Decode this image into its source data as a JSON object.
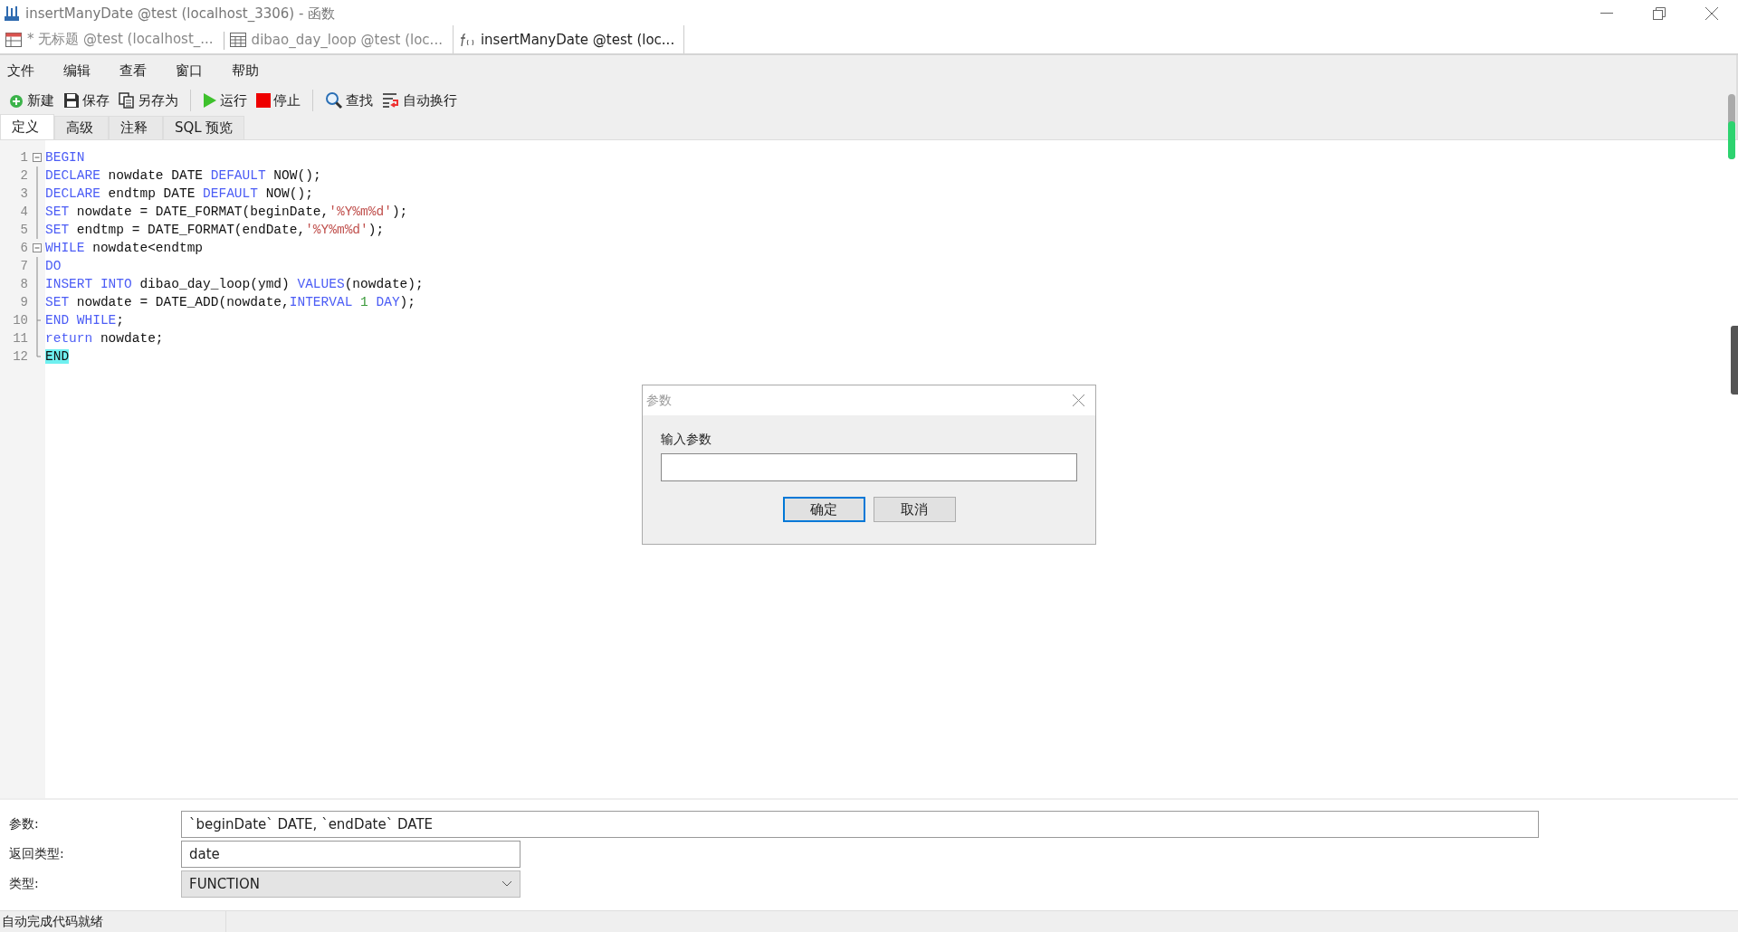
{
  "window": {
    "title": "insertManyDate @test (localhost_3306) - 函数"
  },
  "doc_tabs": [
    {
      "label": "* 无标题 @test (localhost_...",
      "selected": false
    },
    {
      "label": "dibao_day_loop @test (loc...",
      "selected": false
    },
    {
      "label": "insertManyDate @test (loc...",
      "selected": true
    }
  ],
  "menu": [
    "文件",
    "编辑",
    "查看",
    "窗口",
    "帮助"
  ],
  "toolbar": [
    "新建",
    "保存",
    "另存为",
    "运行",
    "停止",
    "查找",
    "自动换行"
  ],
  "sub_tabs": [
    {
      "label": "定义",
      "selected": true
    },
    {
      "label": "高级",
      "selected": false
    },
    {
      "label": "注释",
      "selected": false
    },
    {
      "label": "SQL 预览",
      "selected": false
    }
  ],
  "code_lines": [
    {
      "number": "1",
      "fold_start": true,
      "fold_end": false,
      "tokens": [
        {
          "kind": "kw",
          "text": "BEGIN"
        }
      ]
    },
    {
      "number": "2",
      "fold_start": false,
      "fold_end": false,
      "tokens": [
        {
          "kind": "kw",
          "text": "DECLARE"
        },
        {
          "kind": "plain",
          "text": " nowdate DATE "
        },
        {
          "kind": "kw",
          "text": "DEFAULT"
        },
        {
          "kind": "plain",
          "text": " NOW();"
        }
      ]
    },
    {
      "number": "3",
      "fold_start": false,
      "fold_end": false,
      "tokens": [
        {
          "kind": "kw",
          "text": "DECLARE"
        },
        {
          "kind": "plain",
          "text": " endtmp DATE "
        },
        {
          "kind": "kw",
          "text": "DEFAULT"
        },
        {
          "kind": "plain",
          "text": " NOW();"
        }
      ]
    },
    {
      "number": "4",
      "fold_start": false,
      "fold_end": false,
      "tokens": [
        {
          "kind": "kw",
          "text": "SET"
        },
        {
          "kind": "plain",
          "text": " nowdate = DATE_FORMAT(beginDate,"
        },
        {
          "kind": "str",
          "text": "'%Y%m%d'"
        },
        {
          "kind": "plain",
          "text": ");"
        }
      ]
    },
    {
      "number": "5",
      "fold_start": false,
      "fold_end": false,
      "tokens": [
        {
          "kind": "kw",
          "text": "SET"
        },
        {
          "kind": "plain",
          "text": " endtmp = DATE_FORMAT(endDate,"
        },
        {
          "kind": "str",
          "text": "'%Y%m%d'"
        },
        {
          "kind": "plain",
          "text": ");"
        }
      ]
    },
    {
      "number": "6",
      "fold_start": true,
      "fold_end": false,
      "tokens": [
        {
          "kind": "kw",
          "text": "WHILE"
        },
        {
          "kind": "plain",
          "text": " nowdate<endtmp"
        }
      ]
    },
    {
      "number": "7",
      "fold_start": false,
      "fold_end": false,
      "tokens": [
        {
          "kind": "kw",
          "text": "DO"
        }
      ]
    },
    {
      "number": "8",
      "fold_start": false,
      "fold_end": false,
      "tokens": [
        {
          "kind": "kw",
          "text": "INSERT INTO"
        },
        {
          "kind": "plain",
          "text": " dibao_day_loop(ymd) "
        },
        {
          "kind": "kw",
          "text": "VALUES"
        },
        {
          "kind": "plain",
          "text": "(nowdate);"
        }
      ]
    },
    {
      "number": "9",
      "fold_start": false,
      "fold_end": false,
      "tokens": [
        {
          "kind": "kw",
          "text": "SET"
        },
        {
          "kind": "plain",
          "text": " nowdate = DATE_ADD(nowdate,"
        },
        {
          "kind": "kw",
          "text": "INTERVAL"
        },
        {
          "kind": "num",
          "text": " 1"
        },
        {
          "kind": "kw",
          "text": " DAY"
        },
        {
          "kind": "plain",
          "text": ");"
        }
      ]
    },
    {
      "number": "10",
      "fold_start": false,
      "fold_end": true,
      "tokens": [
        {
          "kind": "kw",
          "text": "END WHILE"
        },
        {
          "kind": "plain",
          "text": ";"
        }
      ]
    },
    {
      "number": "11",
      "fold_start": false,
      "fold_end": false,
      "tokens": [
        {
          "kind": "kw",
          "text": "return"
        },
        {
          "kind": "plain",
          "text": " nowdate;"
        }
      ]
    },
    {
      "number": "12",
      "fold_start": false,
      "fold_end": true,
      "tokens": [
        {
          "kind": "match",
          "text": "END"
        }
      ]
    }
  ],
  "dialog": {
    "title": "参数",
    "label": "输入参数",
    "buttons": [
      {
        "label": "确定",
        "default": true
      },
      {
        "label": "取消",
        "default": false
      }
    ]
  },
  "properties": [
    {
      "label": "参数:",
      "kind": "text",
      "value": "`beginDate` DATE, `endDate` DATE"
    },
    {
      "label": "返回类型:",
      "kind": "text",
      "value": "date"
    },
    {
      "label": "类型:",
      "kind": "select",
      "value": "FUNCTION"
    }
  ],
  "status_bar": "自动完成代码就绪"
}
